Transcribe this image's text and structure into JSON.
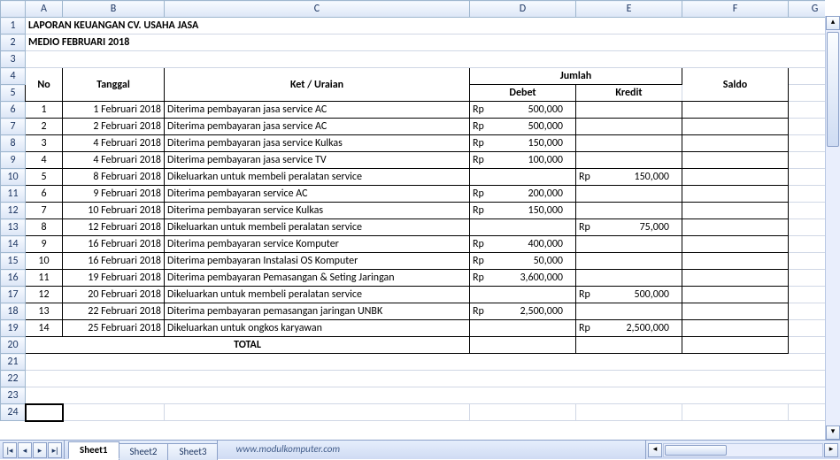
{
  "columns": [
    "A",
    "B",
    "C",
    "D",
    "E",
    "F",
    "G"
  ],
  "title1": "LAPORAN KEUANGAN CV. USAHA JASA",
  "title2": "MEDIO FEBRUARI 2018",
  "headers": {
    "no": "No",
    "tanggal": "Tanggal",
    "ket": "Ket / Uraian",
    "jumlah": "Jumlah",
    "debet": "Debet",
    "kredit": "Kredit",
    "saldo": "Saldo"
  },
  "currency": "Rp",
  "rows": [
    {
      "no": "1",
      "tgl": "1 Februari 2018",
      "ket": "Diterima pembayaran jasa service AC",
      "debet": "500,000",
      "kredit": ""
    },
    {
      "no": "2",
      "tgl": "2 Februari 2018",
      "ket": "Diterima pembayaran jasa service AC",
      "debet": "500,000",
      "kredit": ""
    },
    {
      "no": "3",
      "tgl": "4 Februari 2018",
      "ket": "Diterima pembayaran jasa service Kulkas",
      "debet": "150,000",
      "kredit": ""
    },
    {
      "no": "4",
      "tgl": "4 Februari 2018",
      "ket": "Diterima pembayaran jasa service TV",
      "debet": "100,000",
      "kredit": ""
    },
    {
      "no": "5",
      "tgl": "8 Februari 2018",
      "ket": "Dikeluarkan untuk membeli peralatan service",
      "debet": "",
      "kredit": "150,000"
    },
    {
      "no": "6",
      "tgl": "9 Februari 2018",
      "ket": "Diterima pembayaran service AC",
      "debet": "200,000",
      "kredit": ""
    },
    {
      "no": "7",
      "tgl": "10 Februari 2018",
      "ket": "Diterima pembayaran service Kulkas",
      "debet": "150,000",
      "kredit": ""
    },
    {
      "no": "8",
      "tgl": "12 Februari 2018",
      "ket": "Dikeluarkan untuk membeli peralatan service",
      "debet": "",
      "kredit": "75,000"
    },
    {
      "no": "9",
      "tgl": "16 Februari 2018",
      "ket": "Diterima pembayaran service Komputer",
      "debet": "400,000",
      "kredit": ""
    },
    {
      "no": "10",
      "tgl": "16 Februari 2018",
      "ket": "Diterima pembayaran Instalasi OS Komputer",
      "debet": "50,000",
      "kredit": ""
    },
    {
      "no": "11",
      "tgl": "19 Februari 2018",
      "ket": "Diterima pembayaran Pemasangan & Seting Jaringan",
      "debet": "3,600,000",
      "kredit": ""
    },
    {
      "no": "12",
      "tgl": "20 Februari 2018",
      "ket": "Dikeluarkan untuk membeli peralatan service",
      "debet": "",
      "kredit": "500,000"
    },
    {
      "no": "13",
      "tgl": "22 Februari 2018",
      "ket": "Diterima pembayaran pemasangan jaringan UNBK",
      "debet": "2,500,000",
      "kredit": ""
    },
    {
      "no": "14",
      "tgl": "25 Februari 2018",
      "ket": "Dikeluarkan untuk ongkos karyawan",
      "debet": "",
      "kredit": "2,500,000"
    }
  ],
  "total_label": "TOTAL",
  "tabs": {
    "sheet1": "Sheet1",
    "sheet2": "Sheet2",
    "sheet3": "Sheet3"
  },
  "footer_text": "www.modulkomputer.com",
  "nav": {
    "first": "|◂",
    "prev": "◂",
    "next": "▸",
    "last": "▸|"
  },
  "scroll": {
    "left": "◂",
    "right": "▸",
    "up": "▴",
    "down": "▾"
  },
  "chart_data": {
    "type": "table",
    "title": "LAPORAN KEUANGAN CV. USAHA JASA — MEDIO FEBRUARI 2018",
    "columns": [
      "No",
      "Tanggal",
      "Ket / Uraian",
      "Debet",
      "Kredit"
    ],
    "rows": [
      [
        1,
        "1 Februari 2018",
        "Diterima pembayaran jasa service AC",
        500000,
        null
      ],
      [
        2,
        "2 Februari 2018",
        "Diterima pembayaran jasa service AC",
        500000,
        null
      ],
      [
        3,
        "4 Februari 2018",
        "Diterima pembayaran jasa service Kulkas",
        150000,
        null
      ],
      [
        4,
        "4 Februari 2018",
        "Diterima pembayaran jasa service TV",
        100000,
        null
      ],
      [
        5,
        "8 Februari 2018",
        "Dikeluarkan untuk membeli peralatan service",
        null,
        150000
      ],
      [
        6,
        "9 Februari 2018",
        "Diterima pembayaran service AC",
        200000,
        null
      ],
      [
        7,
        "10 Februari 2018",
        "Diterima pembayaran service Kulkas",
        150000,
        null
      ],
      [
        8,
        "12 Februari 2018",
        "Dikeluarkan untuk membeli peralatan service",
        null,
        75000
      ],
      [
        9,
        "16 Februari 2018",
        "Diterima pembayaran service Komputer",
        400000,
        null
      ],
      [
        10,
        "16 Februari 2018",
        "Diterima pembayaran Instalasi OS Komputer",
        50000,
        null
      ],
      [
        11,
        "19 Februari 2018",
        "Diterima pembayaran Pemasangan & Seting Jaringan",
        3600000,
        null
      ],
      [
        12,
        "20 Februari 2018",
        "Dikeluarkan untuk membeli peralatan service",
        null,
        500000
      ],
      [
        13,
        "22 Februari 2018",
        "Diterima pembayaran pemasangan jaringan UNBK",
        2500000,
        null
      ],
      [
        14,
        "25 Februari 2018",
        "Dikeluarkan untuk ongkos karyawan",
        null,
        2500000
      ]
    ]
  }
}
